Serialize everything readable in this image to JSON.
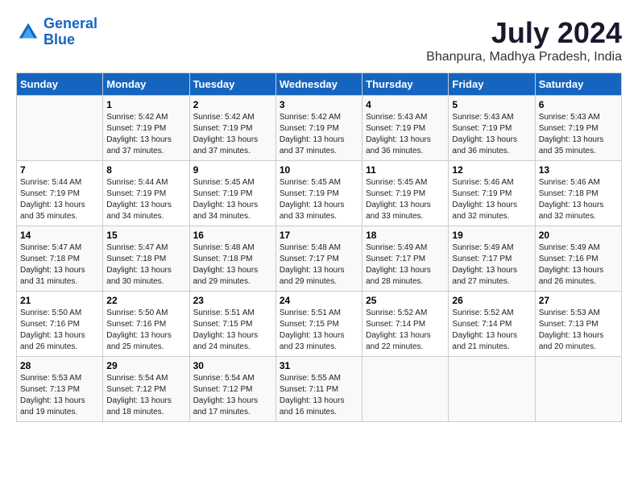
{
  "header": {
    "logo_line1": "General",
    "logo_line2": "Blue",
    "month_year": "July 2024",
    "location": "Bhanpura, Madhya Pradesh, India"
  },
  "days_of_week": [
    "Sunday",
    "Monday",
    "Tuesday",
    "Wednesday",
    "Thursday",
    "Friday",
    "Saturday"
  ],
  "weeks": [
    [
      {
        "day": "",
        "sunrise": "",
        "sunset": "",
        "daylight": ""
      },
      {
        "day": "1",
        "sunrise": "Sunrise: 5:42 AM",
        "sunset": "Sunset: 7:19 PM",
        "daylight": "Daylight: 13 hours and 37 minutes."
      },
      {
        "day": "2",
        "sunrise": "Sunrise: 5:42 AM",
        "sunset": "Sunset: 7:19 PM",
        "daylight": "Daylight: 13 hours and 37 minutes."
      },
      {
        "day": "3",
        "sunrise": "Sunrise: 5:42 AM",
        "sunset": "Sunset: 7:19 PM",
        "daylight": "Daylight: 13 hours and 37 minutes."
      },
      {
        "day": "4",
        "sunrise": "Sunrise: 5:43 AM",
        "sunset": "Sunset: 7:19 PM",
        "daylight": "Daylight: 13 hours and 36 minutes."
      },
      {
        "day": "5",
        "sunrise": "Sunrise: 5:43 AM",
        "sunset": "Sunset: 7:19 PM",
        "daylight": "Daylight: 13 hours and 36 minutes."
      },
      {
        "day": "6",
        "sunrise": "Sunrise: 5:43 AM",
        "sunset": "Sunset: 7:19 PM",
        "daylight": "Daylight: 13 hours and 35 minutes."
      }
    ],
    [
      {
        "day": "7",
        "sunrise": "Sunrise: 5:44 AM",
        "sunset": "Sunset: 7:19 PM",
        "daylight": "Daylight: 13 hours and 35 minutes."
      },
      {
        "day": "8",
        "sunrise": "Sunrise: 5:44 AM",
        "sunset": "Sunset: 7:19 PM",
        "daylight": "Daylight: 13 hours and 34 minutes."
      },
      {
        "day": "9",
        "sunrise": "Sunrise: 5:45 AM",
        "sunset": "Sunset: 7:19 PM",
        "daylight": "Daylight: 13 hours and 34 minutes."
      },
      {
        "day": "10",
        "sunrise": "Sunrise: 5:45 AM",
        "sunset": "Sunset: 7:19 PM",
        "daylight": "Daylight: 13 hours and 33 minutes."
      },
      {
        "day": "11",
        "sunrise": "Sunrise: 5:45 AM",
        "sunset": "Sunset: 7:19 PM",
        "daylight": "Daylight: 13 hours and 33 minutes."
      },
      {
        "day": "12",
        "sunrise": "Sunrise: 5:46 AM",
        "sunset": "Sunset: 7:19 PM",
        "daylight": "Daylight: 13 hours and 32 minutes."
      },
      {
        "day": "13",
        "sunrise": "Sunrise: 5:46 AM",
        "sunset": "Sunset: 7:18 PM",
        "daylight": "Daylight: 13 hours and 32 minutes."
      }
    ],
    [
      {
        "day": "14",
        "sunrise": "Sunrise: 5:47 AM",
        "sunset": "Sunset: 7:18 PM",
        "daylight": "Daylight: 13 hours and 31 minutes."
      },
      {
        "day": "15",
        "sunrise": "Sunrise: 5:47 AM",
        "sunset": "Sunset: 7:18 PM",
        "daylight": "Daylight: 13 hours and 30 minutes."
      },
      {
        "day": "16",
        "sunrise": "Sunrise: 5:48 AM",
        "sunset": "Sunset: 7:18 PM",
        "daylight": "Daylight: 13 hours and 29 minutes."
      },
      {
        "day": "17",
        "sunrise": "Sunrise: 5:48 AM",
        "sunset": "Sunset: 7:17 PM",
        "daylight": "Daylight: 13 hours and 29 minutes."
      },
      {
        "day": "18",
        "sunrise": "Sunrise: 5:49 AM",
        "sunset": "Sunset: 7:17 PM",
        "daylight": "Daylight: 13 hours and 28 minutes."
      },
      {
        "day": "19",
        "sunrise": "Sunrise: 5:49 AM",
        "sunset": "Sunset: 7:17 PM",
        "daylight": "Daylight: 13 hours and 27 minutes."
      },
      {
        "day": "20",
        "sunrise": "Sunrise: 5:49 AM",
        "sunset": "Sunset: 7:16 PM",
        "daylight": "Daylight: 13 hours and 26 minutes."
      }
    ],
    [
      {
        "day": "21",
        "sunrise": "Sunrise: 5:50 AM",
        "sunset": "Sunset: 7:16 PM",
        "daylight": "Daylight: 13 hours and 26 minutes."
      },
      {
        "day": "22",
        "sunrise": "Sunrise: 5:50 AM",
        "sunset": "Sunset: 7:16 PM",
        "daylight": "Daylight: 13 hours and 25 minutes."
      },
      {
        "day": "23",
        "sunrise": "Sunrise: 5:51 AM",
        "sunset": "Sunset: 7:15 PM",
        "daylight": "Daylight: 13 hours and 24 minutes."
      },
      {
        "day": "24",
        "sunrise": "Sunrise: 5:51 AM",
        "sunset": "Sunset: 7:15 PM",
        "daylight": "Daylight: 13 hours and 23 minutes."
      },
      {
        "day": "25",
        "sunrise": "Sunrise: 5:52 AM",
        "sunset": "Sunset: 7:14 PM",
        "daylight": "Daylight: 13 hours and 22 minutes."
      },
      {
        "day": "26",
        "sunrise": "Sunrise: 5:52 AM",
        "sunset": "Sunset: 7:14 PM",
        "daylight": "Daylight: 13 hours and 21 minutes."
      },
      {
        "day": "27",
        "sunrise": "Sunrise: 5:53 AM",
        "sunset": "Sunset: 7:13 PM",
        "daylight": "Daylight: 13 hours and 20 minutes."
      }
    ],
    [
      {
        "day": "28",
        "sunrise": "Sunrise: 5:53 AM",
        "sunset": "Sunset: 7:13 PM",
        "daylight": "Daylight: 13 hours and 19 minutes."
      },
      {
        "day": "29",
        "sunrise": "Sunrise: 5:54 AM",
        "sunset": "Sunset: 7:12 PM",
        "daylight": "Daylight: 13 hours and 18 minutes."
      },
      {
        "day": "30",
        "sunrise": "Sunrise: 5:54 AM",
        "sunset": "Sunset: 7:12 PM",
        "daylight": "Daylight: 13 hours and 17 minutes."
      },
      {
        "day": "31",
        "sunrise": "Sunrise: 5:55 AM",
        "sunset": "Sunset: 7:11 PM",
        "daylight": "Daylight: 13 hours and 16 minutes."
      },
      {
        "day": "",
        "sunrise": "",
        "sunset": "",
        "daylight": ""
      },
      {
        "day": "",
        "sunrise": "",
        "sunset": "",
        "daylight": ""
      },
      {
        "day": "",
        "sunrise": "",
        "sunset": "",
        "daylight": ""
      }
    ]
  ]
}
